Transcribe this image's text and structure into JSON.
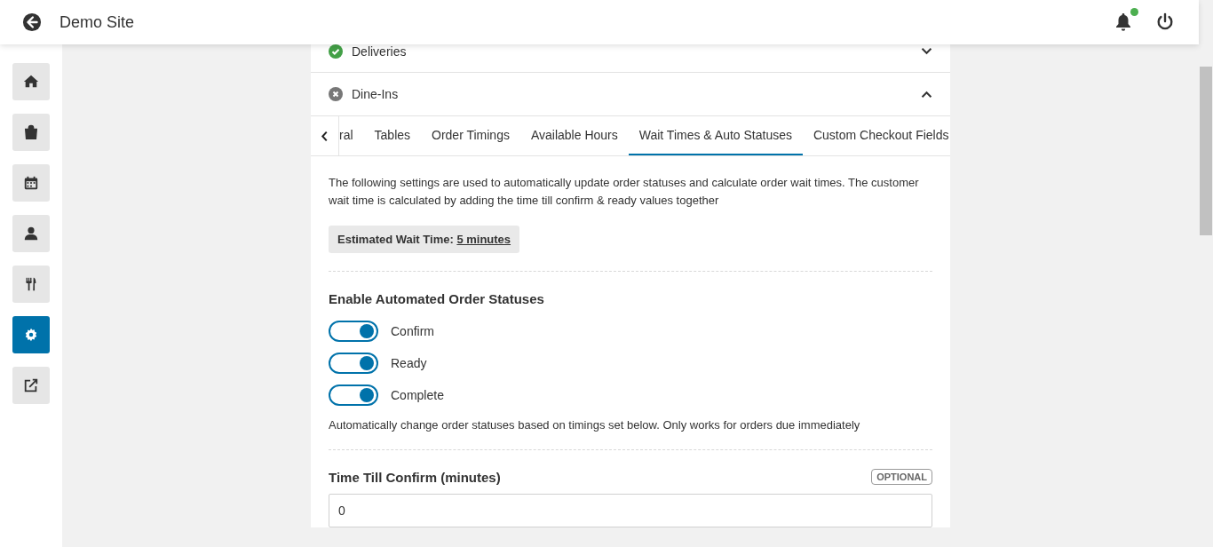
{
  "header": {
    "title": "Demo Site",
    "notification_dot": true
  },
  "nav": [
    {
      "selected": false
    },
    {
      "selected": false
    },
    {
      "selected": false
    },
    {
      "selected": false
    },
    {
      "selected": false
    },
    {
      "selected": true
    },
    {
      "selected": false
    }
  ],
  "panels": [
    {
      "title": "Deliveries",
      "enabled": true,
      "expanded": false
    },
    {
      "title": "Dine-Ins",
      "enabled": false,
      "expanded": true
    }
  ],
  "tabs": [
    {
      "label": "ral",
      "selected": false
    },
    {
      "label": "Tables",
      "selected": false
    },
    {
      "label": "Order Timings",
      "selected": false
    },
    {
      "label": "Available Hours",
      "selected": false
    },
    {
      "label": "Wait Times & Auto Statuses",
      "selected": true
    },
    {
      "label": "Custom Checkout Fields",
      "selected": false
    }
  ],
  "description": "The following settings are used to automatically update order statuses and calculate order wait times. The customer wait time is calculated by adding the time till confirm & ready values together",
  "estimate": {
    "label": "Estimated Wait Time:",
    "value": "5 minutes"
  },
  "auto_statuses": {
    "heading": "Enable Automated Order Statuses",
    "toggles": [
      {
        "label": "Confirm",
        "on": true
      },
      {
        "label": "Ready",
        "on": true
      },
      {
        "label": "Complete",
        "on": true
      }
    ],
    "help": "Automatically change order statuses based on timings set below. Only works for orders due immediately"
  },
  "field": {
    "label": "Time Till Confirm (minutes)",
    "badge": "OPTIONAL",
    "value": "0"
  }
}
